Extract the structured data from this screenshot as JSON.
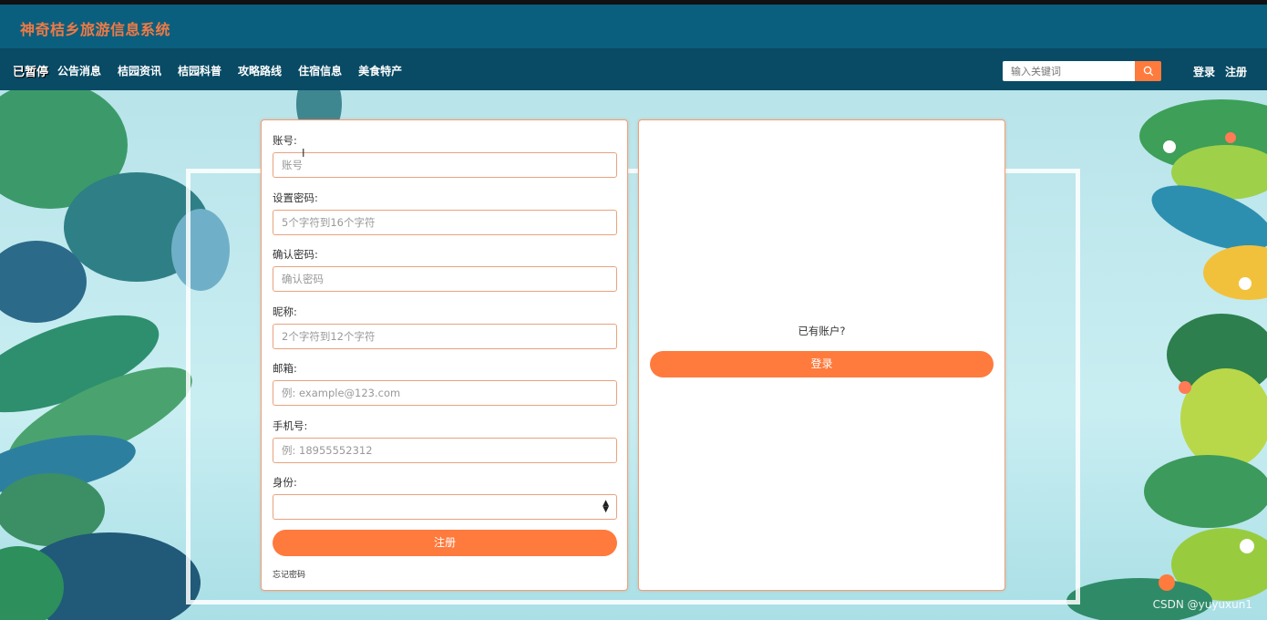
{
  "header": {
    "site_title": "神奇桔乡旅游信息系统"
  },
  "nav": {
    "pause_label": "已暂停",
    "items": [
      "公告消息",
      "桔园资讯",
      "桔园科普",
      "攻略路线",
      "住宿信息",
      "美食特产"
    ],
    "search_placeholder": "输入关键词",
    "login_label": "登录",
    "register_label": "注册"
  },
  "register_form": {
    "fields": [
      {
        "label": "账号:",
        "placeholder": "账号"
      },
      {
        "label": "设置密码:",
        "placeholder": "5个字符到16个字符"
      },
      {
        "label": "确认密码:",
        "placeholder": "确认密码"
      },
      {
        "label": "昵称:",
        "placeholder": "2个字符到12个字符"
      },
      {
        "label": "邮箱:",
        "placeholder": "例: example@123.com"
      },
      {
        "label": "手机号:",
        "placeholder": "例: 18955552312"
      }
    ],
    "identity_label": "身份:",
    "identity_value": "",
    "submit_label": "注册",
    "forgot_label": "忘记密码"
  },
  "login_panel": {
    "prompt": "已有账户?",
    "login_label": "登录"
  },
  "watermark": "CSDN @yuyuxun1",
  "colors": {
    "header_bg": "#0b5f7e",
    "nav_bg": "#094a64",
    "accent": "#ff7a3d",
    "title": "#f07a45"
  }
}
